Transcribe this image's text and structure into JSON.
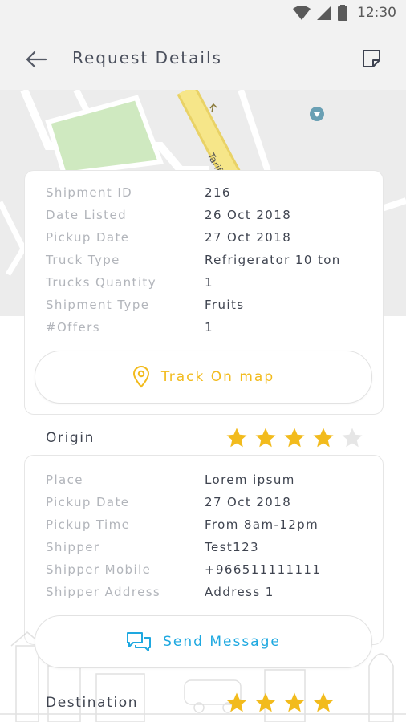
{
  "status_bar": {
    "time": "12:30",
    "icons": [
      "wifi-icon",
      "signal-icon",
      "battery-icon"
    ]
  },
  "header": {
    "title": "Request Details",
    "back_icon": "arrow-left-icon",
    "action_icon": "note-icon"
  },
  "map": {
    "street_label": "Tarif"
  },
  "shipment": {
    "rows": [
      {
        "label": "Shipment ID",
        "value": "216"
      },
      {
        "label": "Date Listed",
        "value": "26 Oct 2018"
      },
      {
        "label": "Pickup Date",
        "value": "27 Oct 2018"
      },
      {
        "label": "Truck Type",
        "value": "Refrigerator 10 ton"
      },
      {
        "label": "Trucks Quantity",
        "value": "1"
      },
      {
        "label": "Shipment Type",
        "value": "Fruits"
      },
      {
        "label": "#Offers",
        "value": "1"
      }
    ],
    "track_button": "Track On map"
  },
  "origin": {
    "title": "Origin",
    "rating": 4,
    "rating_max": 5,
    "rows": [
      {
        "label": "Place",
        "value": "Lorem ipsum"
      },
      {
        "label": "Pickup Date",
        "value": "27 Oct 2018"
      },
      {
        "label": "Pickup Time",
        "value": "From 8am-12pm"
      },
      {
        "label": "Shipper",
        "value": "Test123"
      },
      {
        "label": "Shipper Mobile",
        "value": "+966511111111"
      },
      {
        "label": "Shipper Address",
        "value": "Address 1"
      }
    ],
    "message_button": "Send Message"
  },
  "destination": {
    "title": "Destination",
    "rating": 4,
    "rating_max": 5
  },
  "colors": {
    "accent_yellow": "#f2bb1d",
    "accent_blue": "#1ea8e0",
    "star_empty": "#e6e6e6"
  }
}
